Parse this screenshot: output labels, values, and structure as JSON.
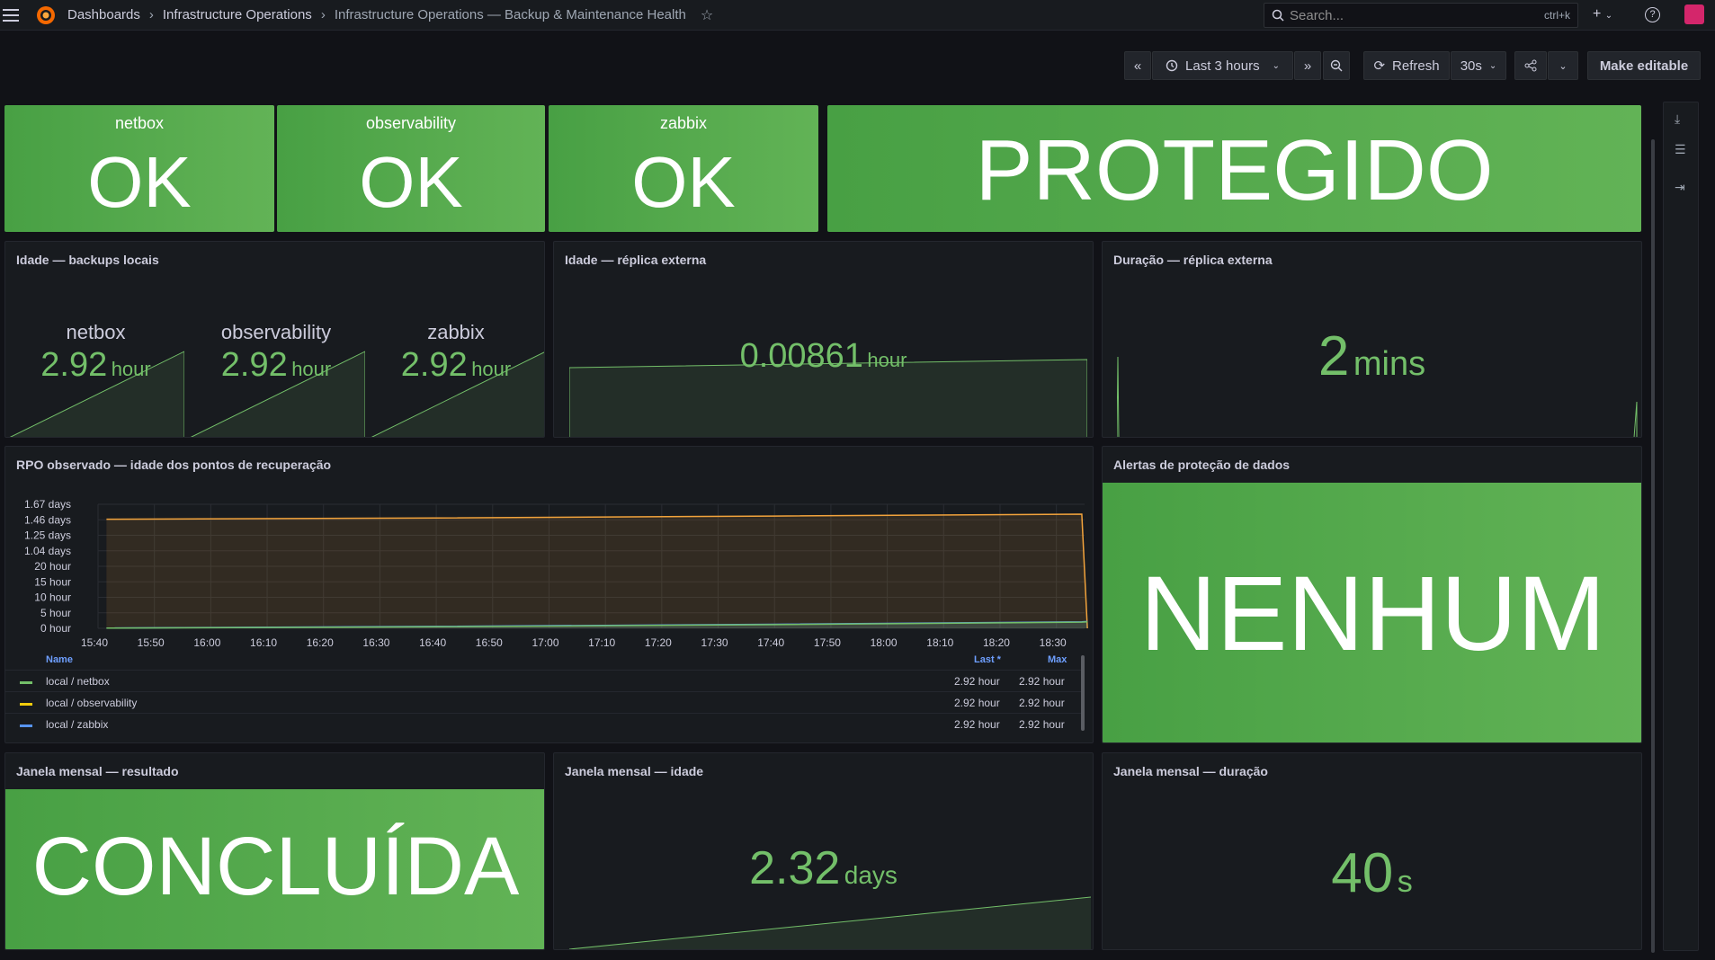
{
  "nav": {
    "breadcrumb": [
      "Dashboards",
      "Infrastructure Operations",
      "Infrastructure Operations — Backup & Maintenance Health"
    ],
    "search_placeholder": "Search...",
    "search_shortcut": "ctrl+k"
  },
  "toolbar": {
    "time_range": "Last 3 hours",
    "refresh_label": "Refresh",
    "refresh_interval": "30s",
    "make_editable": "Make editable"
  },
  "colors": {
    "green": "#56a64b",
    "stat_green": "#73bf69",
    "orange": "#f2a33c",
    "blue": "#5794f2"
  },
  "status_tiles": [
    {
      "name": "netbox",
      "value": "OK"
    },
    {
      "name": "observability",
      "value": "OK"
    },
    {
      "name": "zabbix",
      "value": "OK"
    }
  ],
  "protection": {
    "value": "PROTEGIDO"
  },
  "local_age": {
    "title": "Idade — backups locais",
    "items": [
      {
        "name": "netbox",
        "value": "2.92",
        "unit": "hour"
      },
      {
        "name": "observability",
        "value": "2.92",
        "unit": "hour"
      },
      {
        "name": "zabbix",
        "value": "2.92",
        "unit": "hour"
      }
    ]
  },
  "replica_age": {
    "title": "Idade — réplica externa",
    "value": "0.00861",
    "unit": "hour"
  },
  "replica_duration": {
    "title": "Duração — réplica externa",
    "value": "2",
    "unit": "mins"
  },
  "rpo": {
    "title": "RPO observado — idade dos pontos de recuperação",
    "legend_headers": {
      "name": "Name",
      "last": "Last *",
      "max": "Max"
    },
    "legend": [
      {
        "name": "local / netbox",
        "color": "#73bf69",
        "last": "2.92 hour",
        "max": "2.92 hour"
      },
      {
        "name": "local / observability",
        "color": "#f2cc0c",
        "last": "2.92 hour",
        "max": "2.92 hour"
      },
      {
        "name": "local / zabbix",
        "color": "#5794f2",
        "last": "2.92 hour",
        "max": "2.92 hour"
      }
    ]
  },
  "chart_data": {
    "type": "line",
    "title": "RPO observado — idade dos pontos de recuperação",
    "y_tick_labels": [
      "0 hour",
      "5 hour",
      "10 hour",
      "15 hour",
      "20 hour",
      "1.04 days",
      "1.25 days",
      "1.46 days",
      "1.67 days"
    ],
    "y_tick_hours": [
      0,
      5,
      10,
      15,
      20,
      25,
      30,
      35,
      40
    ],
    "ylim_hours": [
      0,
      40
    ],
    "x_tick_labels": [
      "15:40",
      "15:50",
      "16:00",
      "16:10",
      "16:20",
      "16:30",
      "16:40",
      "16:50",
      "17:00",
      "17:10",
      "17:20",
      "17:30",
      "17:40",
      "17:50",
      "18:00",
      "18:10",
      "18:20",
      "18:30"
    ],
    "x_minutes": [
      0,
      175
    ],
    "series": [
      {
        "name": "local / observability",
        "color": "#f2a33c",
        "x": [
          1.5,
          60,
          120,
          174.5,
          175.5
        ],
        "values": [
          35.2,
          35.6,
          36.2,
          36.8,
          0
        ]
      },
      {
        "name": "local / zabbix",
        "color": "#5794f2",
        "x": [
          1.5,
          60,
          120,
          174.5,
          175.5
        ],
        "values": [
          0.1,
          0.6,
          1.3,
          2.1,
          2.2
        ]
      },
      {
        "name": "local / netbox",
        "color": "#73bf69",
        "x": [
          1.5,
          60,
          120,
          174.5,
          175.5
        ],
        "values": [
          0.05,
          0.5,
          1.2,
          2.0,
          2.1
        ]
      }
    ],
    "grid": true,
    "legend": "bottom"
  },
  "alerts": {
    "title": "Alertas de proteção de dados",
    "value": "NENHUM"
  },
  "monthly_result": {
    "title": "Janela mensal — resultado",
    "value": "CONCLUÍDA"
  },
  "monthly_age": {
    "title": "Janela mensal — idade",
    "value": "2.32",
    "unit": "days"
  },
  "monthly_duration": {
    "title": "Janela mensal — duração",
    "value": "40",
    "unit": "s"
  }
}
